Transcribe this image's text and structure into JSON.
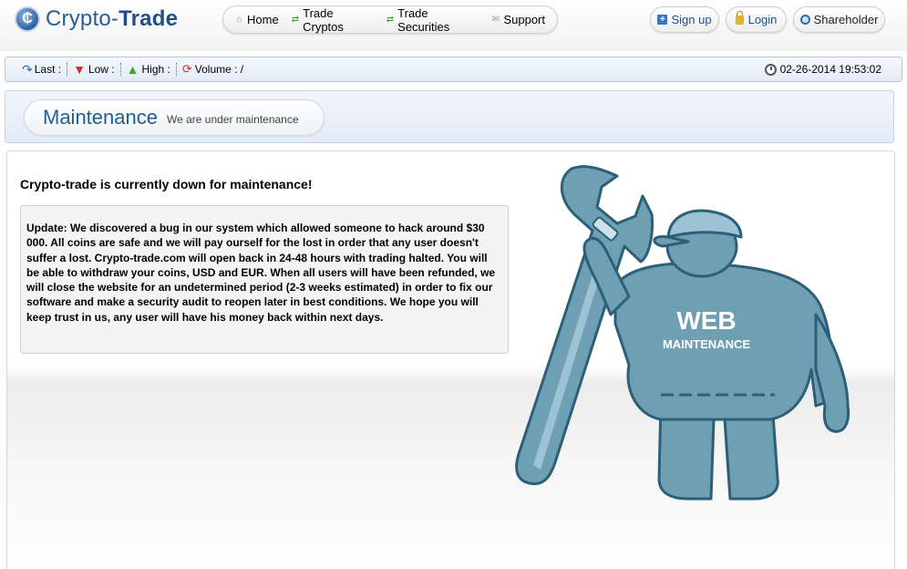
{
  "header": {
    "logo": {
      "prefix": "Crypto-",
      "suffix": "Trade",
      "mark_icon": "crypto-c-logo-icon"
    },
    "nav": [
      {
        "label": "Home",
        "icon": "home-icon"
      },
      {
        "label": "Trade Cryptos",
        "icon": "exchange-icon"
      },
      {
        "label": "Trade Securities",
        "icon": "exchange-icon"
      },
      {
        "label": "Support",
        "icon": "mail-icon"
      }
    ],
    "actions": {
      "signup": "Sign up",
      "login": "Login",
      "shareholder": "Shareholder"
    }
  },
  "ticker": {
    "last_label": "Last :",
    "low_label": "Low :",
    "high_label": "High :",
    "volume_label": "Volume : /",
    "datetime": "02-26-2014 19:53:02"
  },
  "banner": {
    "title": "Maintenance",
    "subtitle": "We are under maintenance"
  },
  "main": {
    "heading": "Crypto-trade is currently down for maintenance!",
    "notice": "Update: We discovered a bug in our system which allowed someone to hack around $30 000. All coins are safe and we will pay ourself for the lost in order that any user doesn't suffer a lost. Crypto-trade.com will open back in 24-48 hours with trading halted. You will be able to withdraw your coins, USD and EUR. When all users will have been refunded, we will close the website for an undetermined period (2-3 weeks estimated) in order to fix our software and make a security audit to reopen later in best conditions. We hope you will keep trust in us, any user will have his money back within next days."
  },
  "illustration": {
    "line1": "WEB",
    "line2": "MAINTENANCE",
    "colors": {
      "body": "#6e9fb3",
      "outline": "#2c5f78",
      "light": "#9cc3d3"
    }
  }
}
